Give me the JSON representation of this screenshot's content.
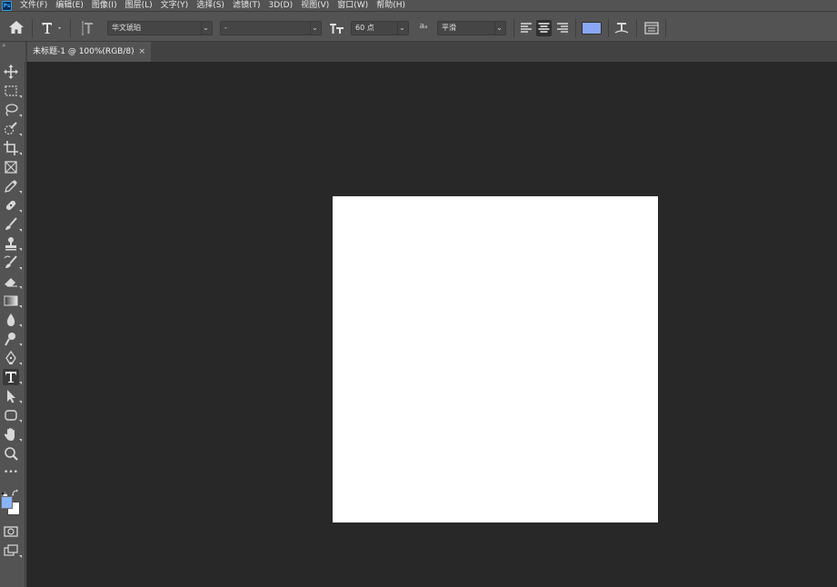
{
  "app": {
    "logo_label": "Ps"
  },
  "menu": {
    "items": [
      "文件(F)",
      "编辑(E)",
      "图像(I)",
      "图层(L)",
      "文字(Y)",
      "选择(S)",
      "滤镜(T)",
      "3D(D)",
      "视图(V)",
      "窗口(W)",
      "帮助(H)"
    ]
  },
  "options_bar": {
    "font_family": "华文琥珀",
    "font_style": "-",
    "font_size": "60 点",
    "antialias_label": "aₐ",
    "antialias": "平滑",
    "text_color": "#8aa7f5"
  },
  "panel_collapse": "»",
  "document_tab": {
    "title": "未标题-1 @ 100%(RGB/8)",
    "close": "×"
  },
  "toolbar": {
    "foreground_color": "#8ab4f8",
    "background_color": "#ffffff",
    "more_label": "•••"
  },
  "colors": {
    "ui_bg": "#535353",
    "workspace_bg": "#282828",
    "canvas": "#ffffff",
    "accent": "#31a8ff"
  }
}
